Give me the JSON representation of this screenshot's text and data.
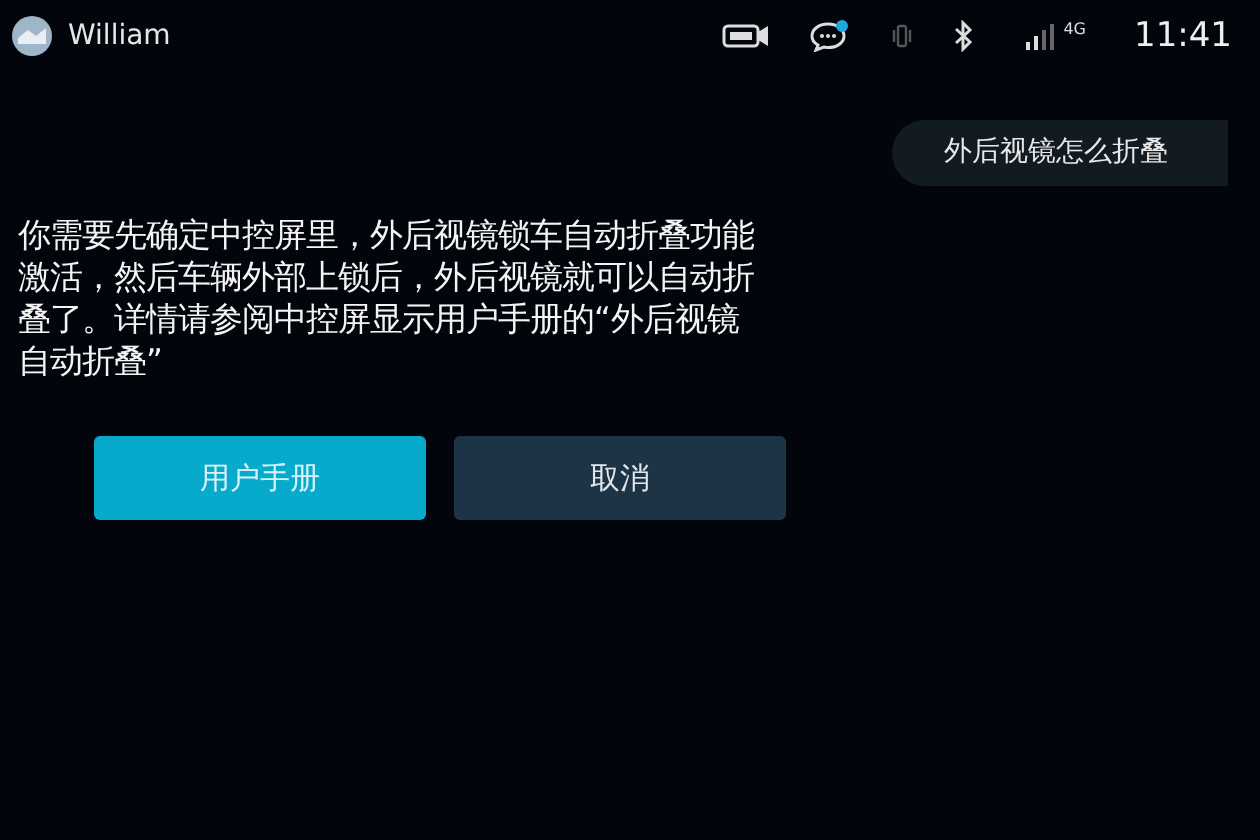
{
  "status_bar": {
    "user_name": "William",
    "network": "4G",
    "time": "11:41",
    "message_unread": true
  },
  "query": "外后视镜怎么折叠",
  "answer": "你需要先确定中控屏里，外后视镜锁车自动折叠功能激活，然后车辆外部上锁后，外后视镜就可以自动折叠了。详情请参阅中控屏显示用户手册的“外后视镜自动折叠”",
  "buttons": [
    {
      "label": "用户手册",
      "kind": "primary"
    },
    {
      "label": "取消",
      "kind": "secondary"
    }
  ]
}
